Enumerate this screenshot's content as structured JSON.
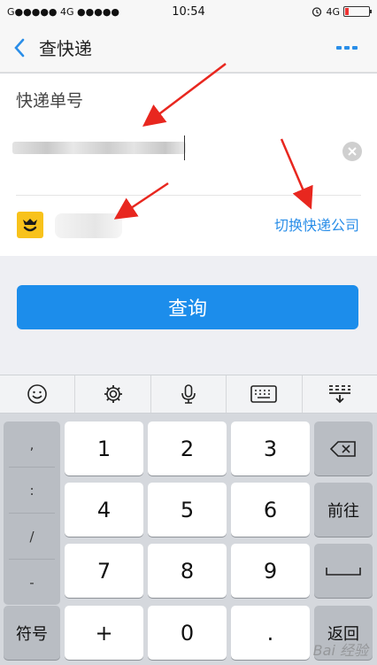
{
  "status_bar": {
    "carrier": "G●●●●● 4G ●●●●●",
    "time": "10:54",
    "network": "4G"
  },
  "nav": {
    "title": "查快递"
  },
  "form": {
    "label": "快递单号",
    "switch_label": "切换快递公司"
  },
  "query": {
    "button_label": "查询"
  },
  "keyboard": {
    "side_keys": [
      ",",
      ":",
      "/",
      "-"
    ],
    "rows": [
      [
        "1",
        "2",
        "3"
      ],
      [
        "4",
        "5",
        "6"
      ],
      [
        "7",
        "8",
        "9"
      ],
      [
        "+",
        "0",
        "."
      ]
    ],
    "symbol_key": "符号",
    "next_key": "前往",
    "return_key": "返回"
  },
  "watermark": "Bai 经验",
  "colors": {
    "accent": "#1c8deb",
    "link": "#2a8ee8",
    "logo": "#f8c21b"
  }
}
